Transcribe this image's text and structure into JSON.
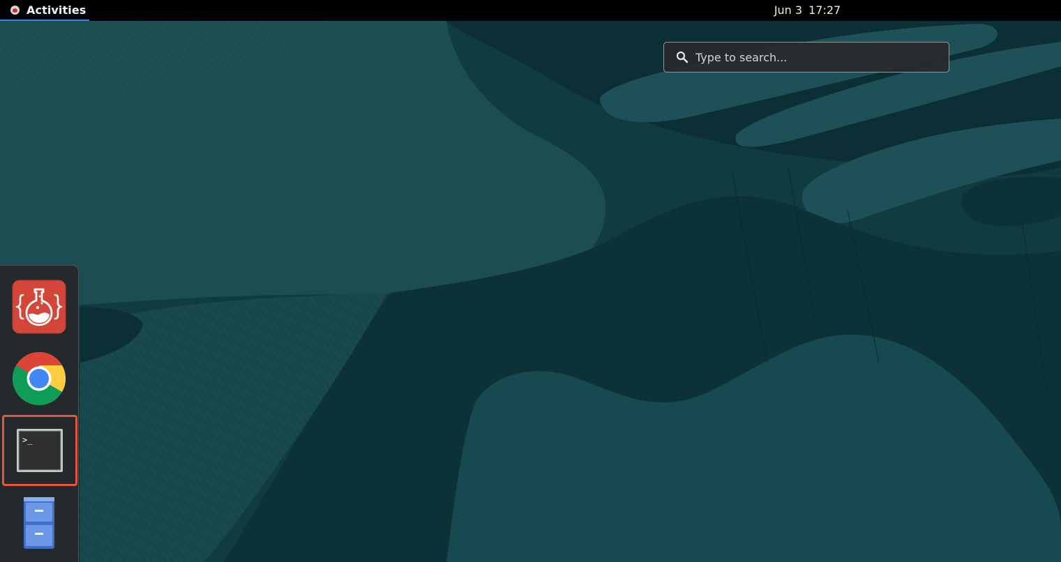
{
  "topbar": {
    "activities_label": "Activities",
    "date": "Jun 3",
    "time": "17:27"
  },
  "search": {
    "placeholder": "Type to search..."
  },
  "dash": {
    "items": [
      {
        "name": "scratch-app",
        "icon": "flask-icon",
        "selected": false
      },
      {
        "name": "google-chrome",
        "icon": "chrome-icon",
        "selected": false
      },
      {
        "name": "terminal",
        "icon": "terminal-icon",
        "selected": true
      },
      {
        "name": "files",
        "icon": "file-cabinet-icon",
        "selected": false
      }
    ]
  },
  "colors": {
    "topbar_bg": "#000000",
    "wallpaper_base": "#0f3a40",
    "selection_outline": "#e8553a",
    "accent": "#3584e4"
  }
}
